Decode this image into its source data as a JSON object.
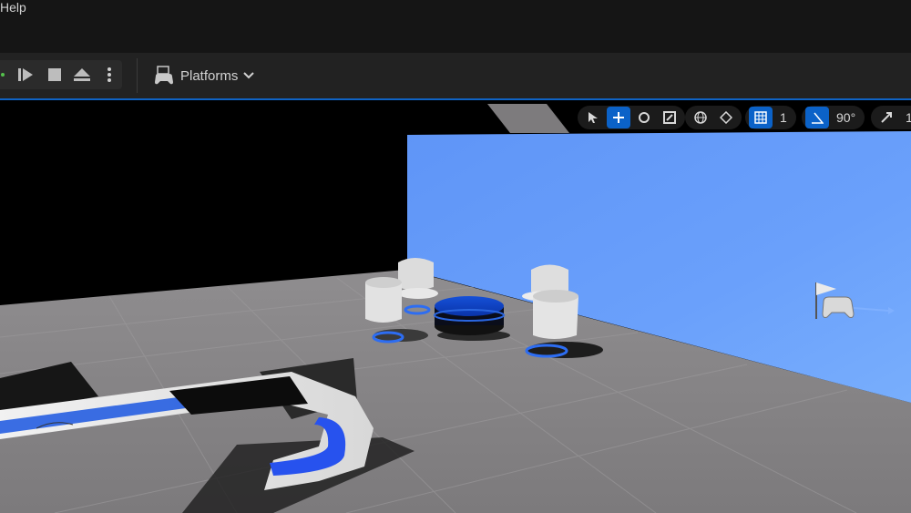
{
  "menubar": {
    "help_label": "Help"
  },
  "toolbar": {
    "platforms_label": "Platforms"
  },
  "viewport_toolbar": {
    "grid_snap_value": "1",
    "angle_snap_value": "90°",
    "scale_snap_value": "1"
  },
  "colors": {
    "accent": "#0b62c8",
    "wall": "#6a9cf8",
    "floor": "#8d8b8d"
  }
}
